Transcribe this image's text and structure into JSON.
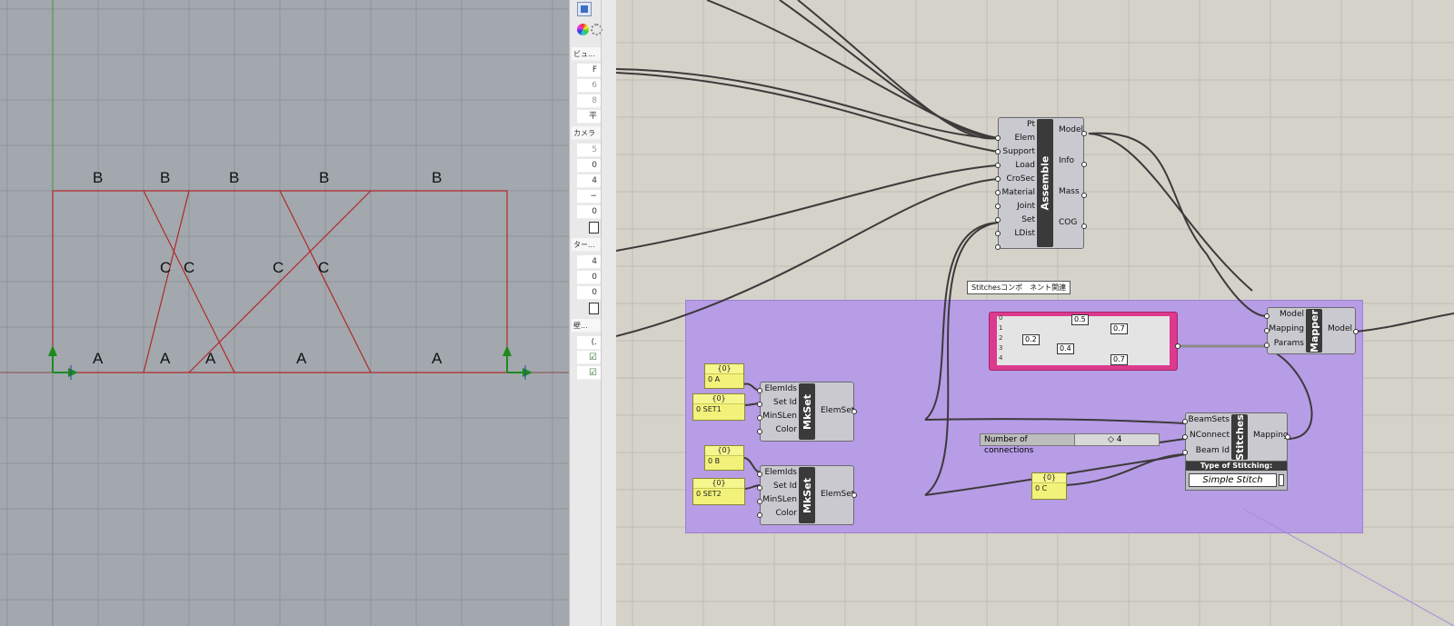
{
  "viewport": {
    "labels": {
      "b1": "B",
      "b2": "B",
      "b3": "B",
      "b4": "B",
      "b5": "B",
      "c1": "C",
      "c2": "C",
      "c3": "C",
      "c4": "C",
      "a1": "A",
      "a2": "A",
      "a3": "A",
      "a4": "A",
      "a5": "A"
    }
  },
  "properties_panel": {
    "section_view": "ビュ...",
    "view_value1": "F",
    "view_value2": "6",
    "view_value3": "8",
    "view_value4": "平",
    "section_camera": "カメラ",
    "cam_value1": "5",
    "cam_value2": "0",
    "cam_value3": "4",
    "cam_value4": "−",
    "cam_value5": "0",
    "section_target": "ター...",
    "tgt_value1": "4",
    "tgt_value2": "0",
    "tgt_value3": "0",
    "section_wallpaper": "壁...",
    "wp_value1": "(.",
    "check1": "☑",
    "check2": "☑"
  },
  "canvas": {
    "group_tooltip": "Stitchesコンポ　ネント関連",
    "assemble": {
      "name": "Assemble",
      "inputs": [
        "Pt",
        "Elem",
        "Support",
        "Load",
        "CroSec",
        "Material",
        "Joint",
        "Set",
        "LDist"
      ],
      "outputs": [
        "Model",
        "Info",
        "Mass",
        "COG"
      ]
    },
    "mapper": {
      "name": "Mapper",
      "inputs": [
        "Model",
        "Mapping",
        "Params"
      ],
      "outputs": [
        "Model"
      ]
    },
    "mkset1": {
      "name": "MkSet",
      "inputs": [
        "ElemIds",
        "Set Id",
        "MinSLen",
        "Color"
      ],
      "outputs": [
        "ElemSet"
      ]
    },
    "mkset2": {
      "name": "MkSet",
      "inputs": [
        "ElemIds",
        "Set Id",
        "MinSLen",
        "Color"
      ],
      "outputs": [
        "ElemSet"
      ]
    },
    "stitches": {
      "name": "Stitches",
      "inputs": [
        "BeamSets",
        "NConnect",
        "Beam Id"
      ],
      "outputs": [
        "Mapping"
      ],
      "type_label": "Type of Stitching:",
      "type_value": "Simple Stitch"
    },
    "slider": {
      "label": "Number of connections",
      "value": "◇ 4"
    },
    "graph_mapper": {
      "indices": [
        "0",
        "1",
        "2",
        "3",
        "4"
      ],
      "values": [
        "0.5",
        "0.7",
        "0.2",
        "0.4",
        "0.7"
      ]
    },
    "panel_a": {
      "head": "{0}",
      "index": "0",
      "text": "A"
    },
    "panel_set1": {
      "head": "{0}",
      "index": "0",
      "text": "SET1"
    },
    "panel_b": {
      "head": "{0}",
      "index": "0",
      "text": "B"
    },
    "panel_set2": {
      "head": "{0}",
      "index": "0",
      "text": "SET2"
    },
    "panel_c": {
      "head": "{0}",
      "index": "0",
      "text": "C"
    }
  }
}
